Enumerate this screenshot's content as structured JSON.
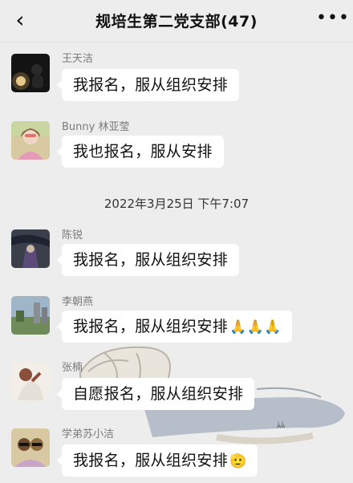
{
  "header": {
    "title": "规培生第二党支部(47)",
    "back_glyph": "‹",
    "more_glyph": "•••"
  },
  "timestamp": "2022年3月25日 下午7:07",
  "messages": [
    {
      "sender": "王天洁",
      "text": "我报名，服从组织安排",
      "emoji": ""
    },
    {
      "sender": "Bunny 林亚莹",
      "text": "我也报名，服从安排",
      "emoji": ""
    },
    {
      "sender": "陈锐",
      "text": "我报名，服从组织安排",
      "emoji": ""
    },
    {
      "sender": "李朝燕",
      "text": "我报名，服从组织安排",
      "emoji": "🙏🙏🙏"
    },
    {
      "sender": "张楠",
      "text": "自愿报名，服从组织安排",
      "emoji": ""
    },
    {
      "sender": "学弟苏小洁",
      "text": "我报名，服从组织安排",
      "emoji": "🫡"
    }
  ]
}
